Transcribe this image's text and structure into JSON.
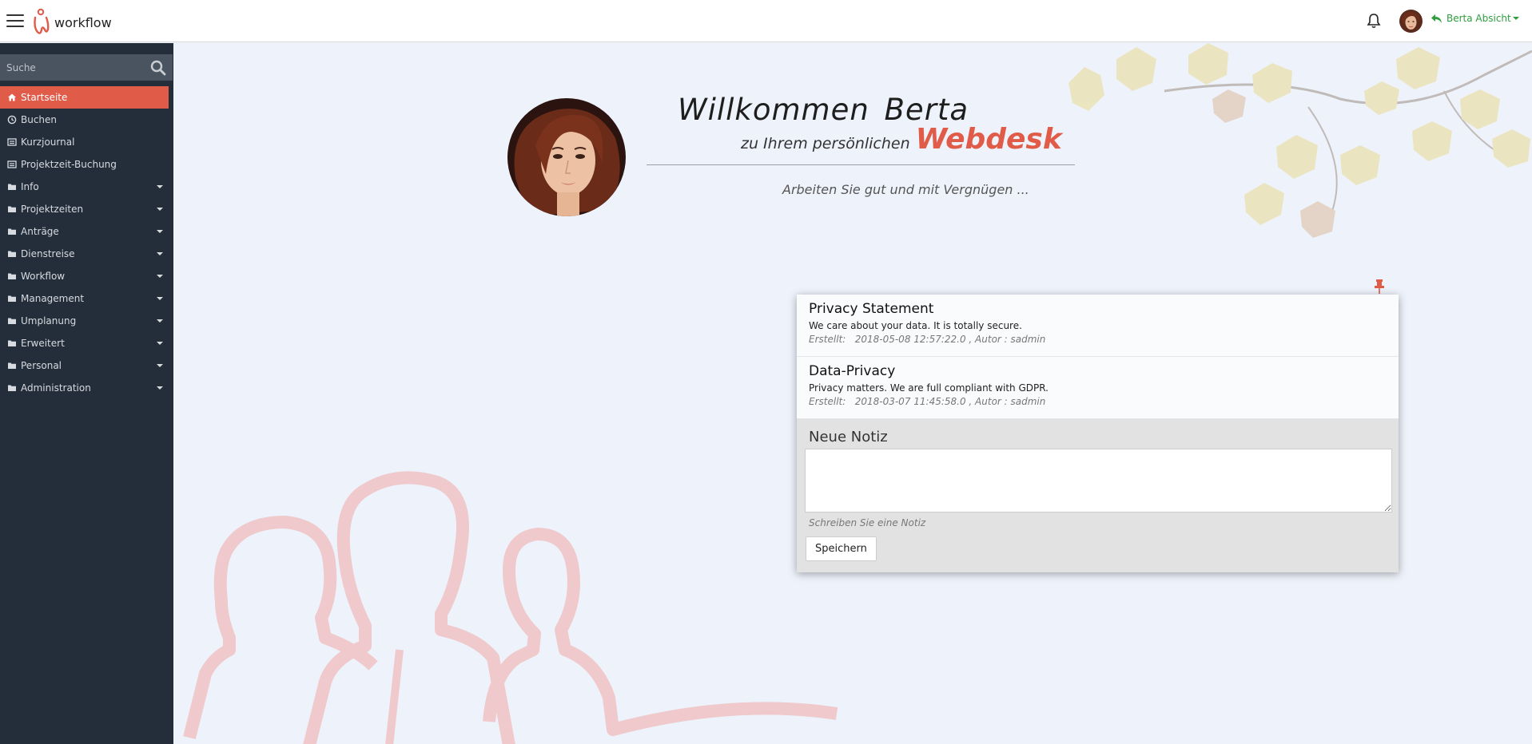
{
  "header": {
    "app_name": "workflow",
    "user_label": "Berta Absicht"
  },
  "sidebar": {
    "search_placeholder": "Suche",
    "items": [
      {
        "label": "Startseite",
        "icon": "home-icon",
        "active": true,
        "dropdown": false
      },
      {
        "label": "Buchen",
        "icon": "clock-icon",
        "active": false,
        "dropdown": false
      },
      {
        "label": "Kurzjournal",
        "icon": "list-icon",
        "active": false,
        "dropdown": false
      },
      {
        "label": "Projektzeit-Buchung",
        "icon": "list-icon",
        "active": false,
        "dropdown": false
      },
      {
        "label": "Info",
        "icon": "folder-icon",
        "active": false,
        "dropdown": true
      },
      {
        "label": "Projektzeiten",
        "icon": "folder-icon",
        "active": false,
        "dropdown": true
      },
      {
        "label": "Anträge",
        "icon": "folder-icon",
        "active": false,
        "dropdown": true
      },
      {
        "label": "Dienstreise",
        "icon": "folder-icon",
        "active": false,
        "dropdown": true
      },
      {
        "label": "Workflow",
        "icon": "folder-icon",
        "active": false,
        "dropdown": true
      },
      {
        "label": "Management",
        "icon": "folder-icon",
        "active": false,
        "dropdown": true
      },
      {
        "label": "Umplanung",
        "icon": "folder-icon",
        "active": false,
        "dropdown": true
      },
      {
        "label": "Erweitert",
        "icon": "folder-icon",
        "active": false,
        "dropdown": true
      },
      {
        "label": "Personal",
        "icon": "folder-icon",
        "active": false,
        "dropdown": true
      },
      {
        "label": "Administration",
        "icon": "folder-icon",
        "active": false,
        "dropdown": true
      }
    ]
  },
  "welcome": {
    "title": "Willkommen Berta",
    "subtitle": "zu Ihrem persönlichen",
    "brand": "Webdesk",
    "motto": "Arbeiten Sie gut und mit Vergnügen ..."
  },
  "notes": [
    {
      "title": "Privacy Statement",
      "text": "We care about your data. It is totally secure.",
      "meta": "Erstellt:   2018-05-08 12:57:22.0 , Autor : sadmin"
    },
    {
      "title": "Data-Privacy",
      "text": "Privacy matters. We are full compliant with GDPR.",
      "meta": "Erstellt:   2018-03-07 11:45:58.0 , Autor : sadmin"
    }
  ],
  "new_note": {
    "title": "Neue Notiz",
    "value": "",
    "hint": "Schreiben Sie eine Notiz",
    "save_label": "Speichern"
  },
  "colors": {
    "accent": "#e05b48",
    "sidebar_bg": "#242d3a",
    "user_green": "#2e9e3e",
    "page_bg": "#eef2fa"
  }
}
